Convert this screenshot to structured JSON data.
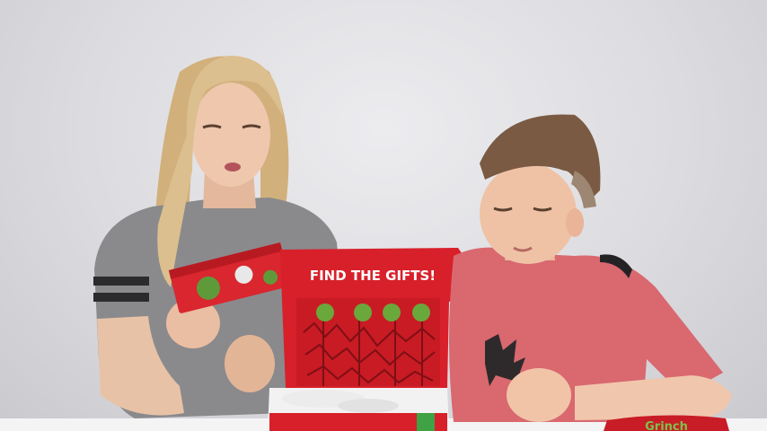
{
  "scene": {
    "box_lid_text": "FIND THE GIFTS!",
    "corner_logo_text": "Grinch"
  },
  "colors": {
    "background_wall": "#dcdce0",
    "table": "#f4f4f4",
    "box_red": "#d8202a",
    "grinch_green": "#6aa83b",
    "girl_shirt": "#8a8a8d",
    "boy_shirt": "#d9686f",
    "hair_blonde": "#d9b98a",
    "hair_brown": "#7a5a42"
  }
}
